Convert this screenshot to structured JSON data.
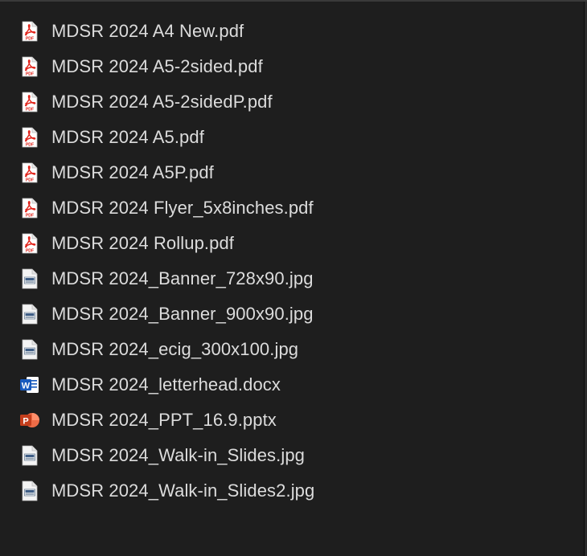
{
  "files": [
    {
      "name": "MDSR 2024 A4 New.pdf",
      "icon": "pdf-icon"
    },
    {
      "name": "MDSR 2024 A5-2sided.pdf",
      "icon": "pdf-icon"
    },
    {
      "name": "MDSR 2024 A5-2sidedP.pdf",
      "icon": "pdf-icon"
    },
    {
      "name": "MDSR 2024 A5.pdf",
      "icon": "pdf-icon"
    },
    {
      "name": "MDSR 2024 A5P.pdf",
      "icon": "pdf-icon"
    },
    {
      "name": "MDSR 2024 Flyer_5x8inches.pdf",
      "icon": "pdf-icon"
    },
    {
      "name": "MDSR 2024 Rollup.pdf",
      "icon": "pdf-icon"
    },
    {
      "name": "MDSR 2024_Banner_728x90.jpg",
      "icon": "jpg-icon"
    },
    {
      "name": "MDSR 2024_Banner_900x90.jpg",
      "icon": "jpg-icon"
    },
    {
      "name": "MDSR 2024_ecig_300x100.jpg",
      "icon": "jpg-icon"
    },
    {
      "name": "MDSR 2024_letterhead.docx",
      "icon": "docx-icon"
    },
    {
      "name": "MDSR 2024_PPT_16.9.pptx",
      "icon": "pptx-icon"
    },
    {
      "name": "MDSR 2024_Walk-in_Slides.jpg",
      "icon": "jpg-icon"
    },
    {
      "name": "MDSR 2024_Walk-in_Slides2.jpg",
      "icon": "jpg-icon"
    }
  ],
  "colors": {
    "background": "#1e1e1e",
    "text": "#dcdcdc",
    "pdf_red": "#e2231a",
    "word_blue": "#185abd",
    "ppt_orange": "#c43e1c"
  }
}
